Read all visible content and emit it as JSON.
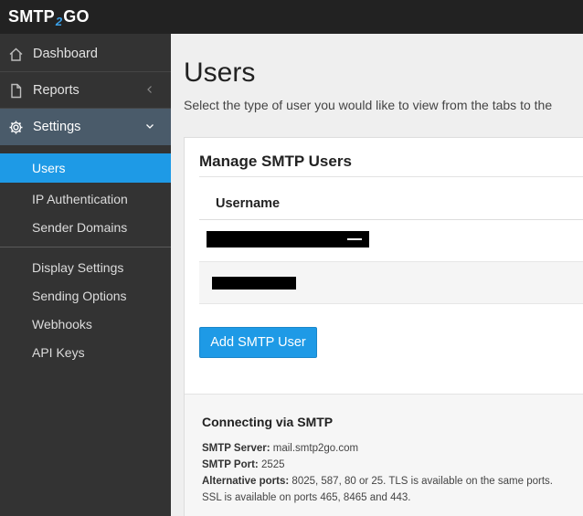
{
  "brand": {
    "logo_left": "SMTP",
    "logo_mid": "2",
    "logo_right": "GO",
    "accent": "#1e9ae6"
  },
  "sidebar": {
    "items": [
      {
        "label": "Dashboard",
        "icon": "home-icon"
      },
      {
        "label": "Reports",
        "icon": "document-icon",
        "chevron": "chevron-left-icon"
      },
      {
        "label": "Settings",
        "icon": "gear-icon",
        "chevron": "chevron-down-icon",
        "expanded": true
      }
    ],
    "settings_children": [
      {
        "label": "Users",
        "active": true
      },
      {
        "label": "IP Authentication"
      },
      {
        "label": "Sender Domains"
      },
      {
        "label": "Display Settings"
      },
      {
        "label": "Sending Options"
      },
      {
        "label": "Webhooks"
      },
      {
        "label": "API Keys"
      }
    ]
  },
  "main": {
    "title": "Users",
    "subtitle": "Select the type of user you would like to view from the tabs to the",
    "card": {
      "title": "Manage SMTP Users",
      "table": {
        "column_header": "Username"
      },
      "add_button": "Add SMTP User",
      "connect": {
        "title": "Connecting via SMTP",
        "server_label": "SMTP Server:",
        "server_value": "mail.smtp2go.com",
        "port_label": "SMTP Port:",
        "port_value": "2525",
        "alt_label": "Alternative ports:",
        "alt_value": "8025, 587, 80 or 25. TLS is available on the same ports.",
        "ssl_line": "SSL is available on ports 465, 8465 and 443."
      }
    }
  }
}
